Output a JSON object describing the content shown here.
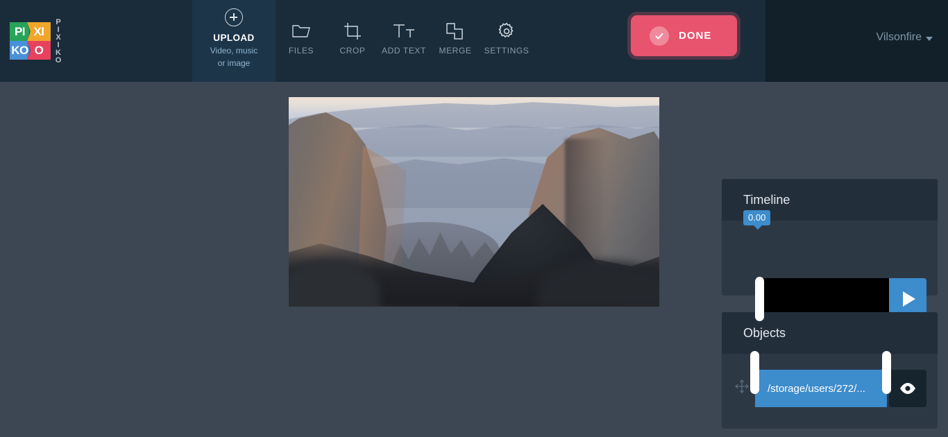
{
  "app": {
    "brand_name": "PIXIKO",
    "logo_blocks": [
      {
        "text": "PI",
        "color": "#27a35a"
      },
      {
        "text": "XI",
        "color": "#f0a62a"
      },
      {
        "text": "KO",
        "color": "#4a90d9"
      },
      {
        "text": "O",
        "color": "#e8415e"
      }
    ],
    "logo_registered_mark": "®"
  },
  "header": {
    "upload": {
      "icon": "plus-circle-icon",
      "title": "UPLOAD",
      "subtitle_line1": "Video, music",
      "subtitle_line2": "or image"
    },
    "tools": [
      {
        "id": "files",
        "label": "FILES",
        "icon": "folder-icon"
      },
      {
        "id": "crop",
        "label": "CROP",
        "icon": "crop-icon"
      },
      {
        "id": "add-text",
        "label": "ADD TEXT",
        "icon": "text-icon"
      },
      {
        "id": "merge",
        "label": "MERGE",
        "icon": "merge-icon"
      },
      {
        "id": "settings",
        "label": "SETTINGS",
        "icon": "gear-icon"
      }
    ],
    "done_button": {
      "label": "DONE",
      "icon": "check-circle-icon",
      "color": "#e8536e"
    },
    "user": {
      "name": "Vilsonfire",
      "caret_icon": "chevron-down-icon"
    }
  },
  "canvas": {
    "preview_alt": "Rocky cliff formations at dusk with hazy mountain layers"
  },
  "timeline": {
    "title": "Timeline",
    "current_time": "0.00",
    "play_icon": "play-icon",
    "accent_color": "#3d8ccc"
  },
  "objects": {
    "title": "Objects",
    "items": [
      {
        "move_icon": "move-icon",
        "label": "/storage/users/272/...",
        "visibility_icon": "eye-icon",
        "color": "#3d8ccc"
      }
    ]
  }
}
